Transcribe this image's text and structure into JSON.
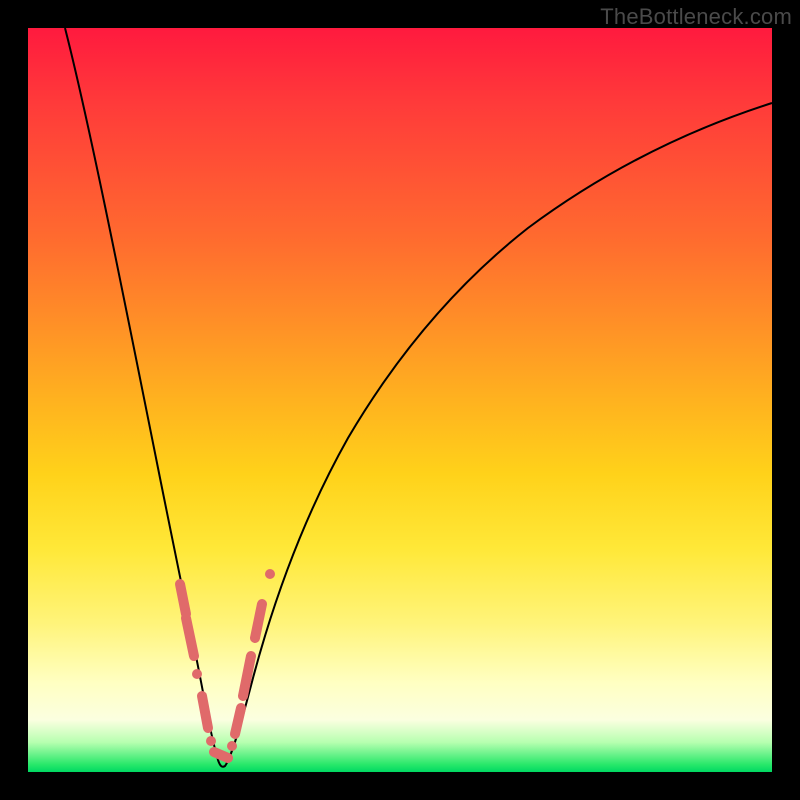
{
  "watermark": "TheBottleneck.com",
  "colors": {
    "frame": "#000000",
    "gradient_top": "#ff1a3e",
    "gradient_bottom": "#00d862",
    "curve": "#000000",
    "markers": "#e06a6a"
  },
  "chart_data": {
    "type": "line",
    "title": "",
    "xlabel": "",
    "ylabel": "",
    "xlim": [
      0,
      100
    ],
    "ylim": [
      0,
      100
    ],
    "vertex_x": 25,
    "series": [
      {
        "name": "bottleneck_curve",
        "x": [
          5,
          8,
          11,
          14,
          17,
          20,
          22,
          23,
          24,
          25,
          26,
          27,
          28,
          30,
          33,
          37,
          42,
          48,
          55,
          63,
          72,
          82,
          92,
          100
        ],
        "y": [
          100,
          86,
          72,
          58,
          44,
          28,
          16,
          10,
          5,
          2,
          4,
          8,
          13,
          22,
          33,
          44,
          54,
          63,
          70,
          76,
          81,
          85,
          88,
          90
        ]
      }
    ],
    "markers": [
      {
        "x_range": [
          20.5,
          21.2
        ],
        "y_range": [
          24,
          20
        ]
      },
      {
        "x_range": [
          21.2,
          22.0
        ],
        "y_range": [
          20,
          15
        ]
      },
      {
        "x": 22.4,
        "y": 13
      },
      {
        "x_range": [
          23.0,
          24.0
        ],
        "y_range": [
          9,
          5
        ]
      },
      {
        "x": 24.3,
        "y": 4
      },
      {
        "x_range": [
          24.6,
          26.4
        ],
        "y_range": [
          2,
          4
        ]
      },
      {
        "x": 26.8,
        "y": 6
      },
      {
        "x_range": [
          27.2,
          28.0
        ],
        "y_range": [
          8,
          12
        ]
      },
      {
        "x_range": [
          28.3,
          29.5
        ],
        "y_range": [
          14,
          20
        ]
      },
      {
        "x_range": [
          30.0,
          30.8
        ],
        "y_range": [
          23,
          27
        ]
      },
      {
        "x": 32.0,
        "y": 31
      }
    ]
  }
}
